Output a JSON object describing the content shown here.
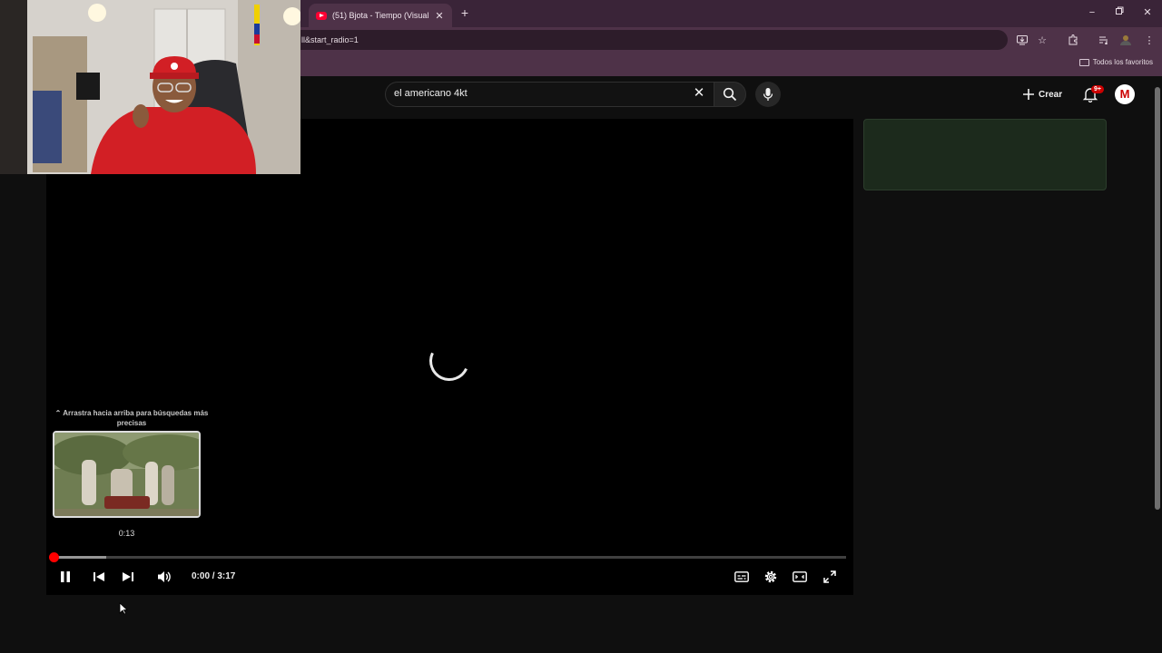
{
  "browser": {
    "tab": {
      "title": "(51) Bjota - Tiempo (Visualizer)"
    },
    "new_tab_symbol": "+",
    "url_fragment": "ll&start_radio=1",
    "bookmarks": {
      "folder_label": "Todos los favoritos"
    }
  },
  "youtube": {
    "search": {
      "value": "el americano 4kt"
    },
    "header": {
      "create_label": "Crear",
      "notification_badge": "9+",
      "avatar_letter": "M"
    },
    "player": {
      "state": "loading",
      "seek_hint": "⌃ Arrastra hacia arriba para búsquedas más precisas",
      "preview_time": "0:13",
      "time_display": "0:00 / 3:17",
      "loaded_fraction": 0.067,
      "played_fraction": 0.0
    }
  },
  "colors": {
    "tab_bar": "#3a2438",
    "toolbar": "#4e3248",
    "youtube_bg": "#0f0f0f",
    "progress_red": "#ff0000",
    "ad_panel": "#1c2a1c"
  },
  "icons": {
    "tabbar": [
      "youtube-favicon-icon",
      "close-icon",
      "plus-icon",
      "minimize-icon",
      "restore-icon",
      "close-window-icon"
    ],
    "toolbar": [
      "install-app-icon",
      "star-icon",
      "extensions-icon",
      "media-control-icon",
      "profile-icon",
      "kebab-menu-icon"
    ],
    "player": [
      "pause-icon",
      "previous-icon",
      "next-icon",
      "volume-icon",
      "subtitles-icon",
      "settings-icon",
      "theater-mode-icon",
      "fullscreen-icon"
    ]
  }
}
